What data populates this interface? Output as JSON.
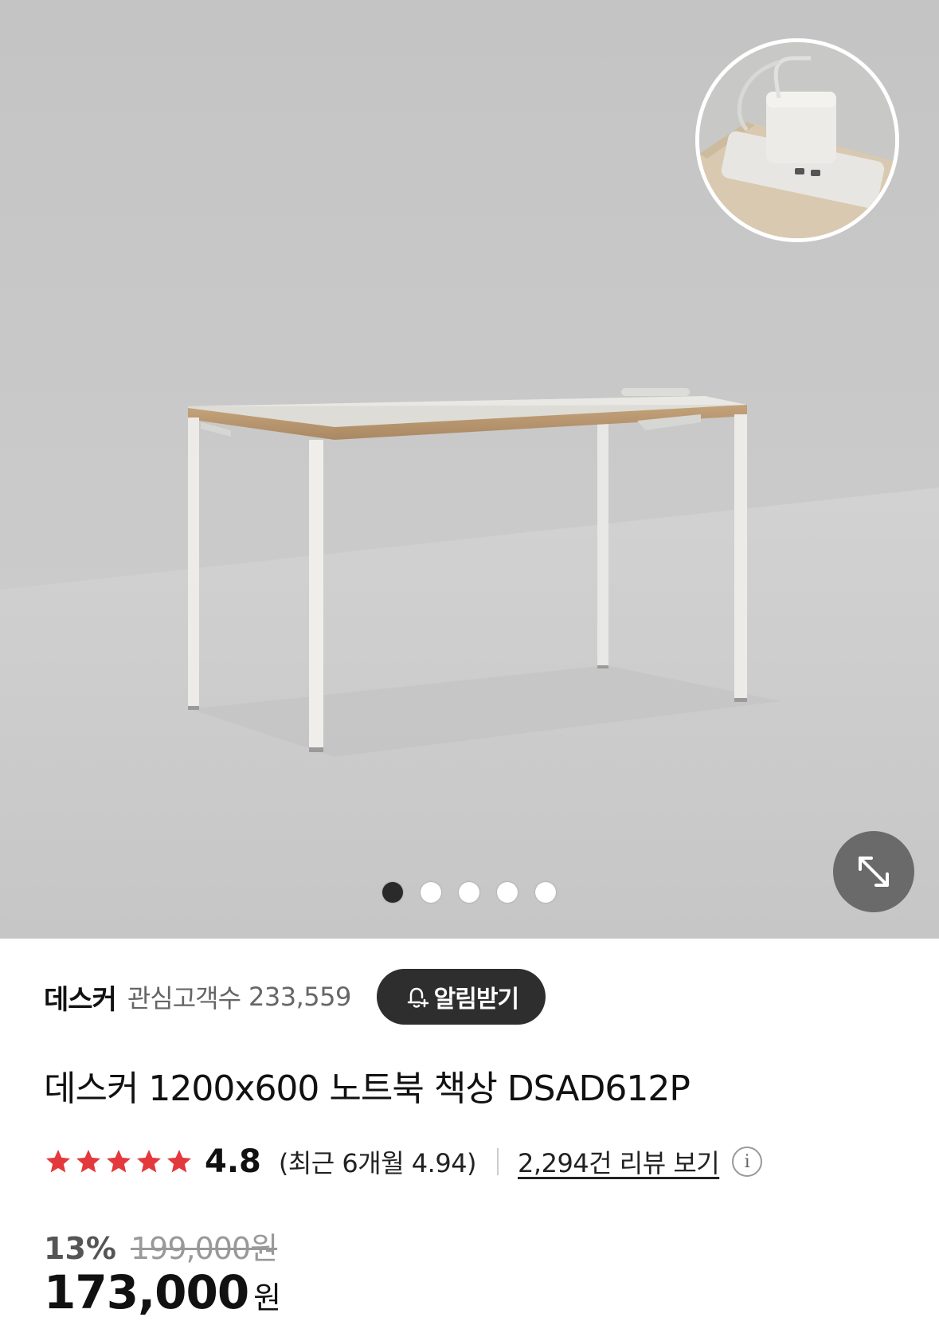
{
  "gallery": {
    "slides_total": 5,
    "active_index": 0
  },
  "store": {
    "brand_name": "데스커",
    "followers_label": "관심고객수",
    "followers_count": "233,559",
    "alarm_button_label": "알림받기"
  },
  "product": {
    "title": "데스커 1200x600 노트북 책상 DSAD612P",
    "rating": {
      "stars": 5,
      "score": "4.8",
      "recent_text": "(최근 6개월 4.94)",
      "review_link_text": "2,294건 리뷰 보기"
    },
    "price": {
      "discount_rate": "13%",
      "original_price": "199,000원",
      "sale_price": "173,000",
      "currency": "원"
    }
  },
  "icons": {
    "expand": "expand-icon",
    "bell": "bell-plus-icon",
    "info": "info-icon",
    "star": "star-icon"
  },
  "colors": {
    "star": "#e4393c",
    "alarm_button_bg": "#2e2e2e",
    "active_dot": "#2a2a2a"
  }
}
